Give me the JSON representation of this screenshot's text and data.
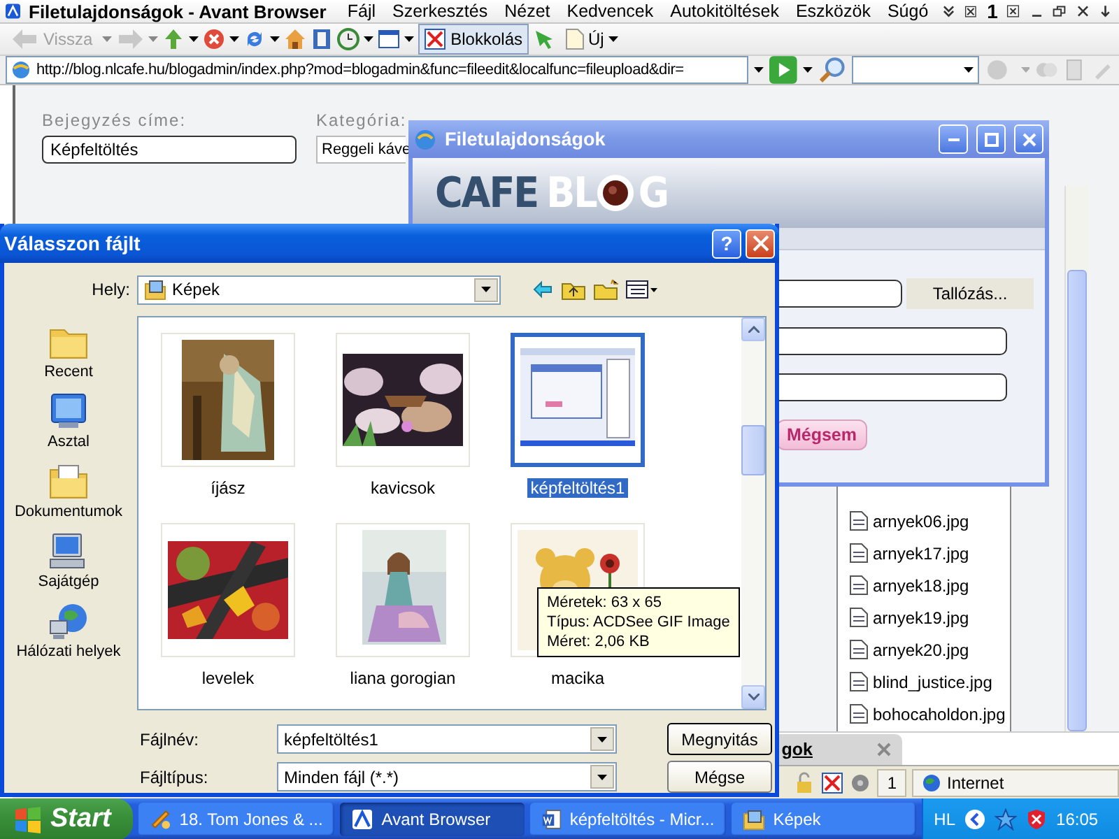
{
  "browser": {
    "title": "Filetulajdonságok - Avant Browser",
    "menu": [
      "Fájl",
      "Szerkesztés",
      "Nézet",
      "Kedvencek",
      "Autokitöltések",
      "Eszközök",
      "Súgó"
    ],
    "tab_count": "1"
  },
  "toolbar": {
    "back": {
      "label": "Vissza",
      "disabled": true
    },
    "block": {
      "label": "Blokkolás",
      "pressed": true
    },
    "new": {
      "label": "Új"
    }
  },
  "address": {
    "url": "http://blog.nlcafe.hu/blogadmin/index.php?mod=blogadmin&func=fileedit&localfunc=fileupload&dir="
  },
  "page": {
    "title_label": "Bejegyzés címe:",
    "title_value": "Képfeltöltés",
    "category_label": "Kategória:",
    "category_value": "Reggeli káve",
    "files": [
      "arnyek06.jpg",
      "arnyek17.jpg",
      "arnyek18.jpg",
      "arnyek19.jpg",
      "arnyek20.jpg",
      "blind_justice.jpg",
      "bohocaholdon.jpg"
    ],
    "tab": {
      "label": "gok"
    },
    "status": {
      "count": "1",
      "zone": "Internet"
    }
  },
  "popup": {
    "title": "Filetulajdonságok",
    "logo": {
      "first": "CAFE",
      "second": "BL",
      "last": "G"
    },
    "browse_button": "Tallózás...",
    "cancel_button": "Mégsem"
  },
  "dialog": {
    "title": "Válasszon fájlt",
    "help": "?",
    "location_label": "Hely:",
    "location": "Képek",
    "places": [
      "Recent",
      "Asztal",
      "Dokumentumok",
      "Sajátgép",
      "Hálózati helyek"
    ],
    "files": [
      {
        "name": "íjász",
        "selected": false
      },
      {
        "name": "kavicsok",
        "selected": false
      },
      {
        "name": "képfeltöltés1",
        "selected": true
      },
      {
        "name": "levelek",
        "selected": false
      },
      {
        "name": "liana gorogian",
        "selected": false
      },
      {
        "name": "macika",
        "selected": false
      }
    ],
    "tooltip": [
      "Méretek: 63 x 65",
      "Típus: ACDSee GIF Image",
      "Méret: 2,06 KB"
    ],
    "filename_label": "Fájlnév:",
    "filename": "képfeltöltés1",
    "filetype_label": "Fájltípus:",
    "filetype": "Minden fájl (*.*)",
    "open_button": "Megnyitás",
    "cancel_button": "Mégse"
  },
  "taskbar": {
    "start": "Start",
    "tasks": [
      {
        "label": "18. Tom Jones & ...",
        "selected": false
      },
      {
        "label": "Avant Browser",
        "selected": true
      },
      {
        "label": "képfeltöltés - Micr...",
        "selected": false
      },
      {
        "label": "Képek",
        "selected": false
      }
    ],
    "language": "HL",
    "clock": "16:05"
  }
}
